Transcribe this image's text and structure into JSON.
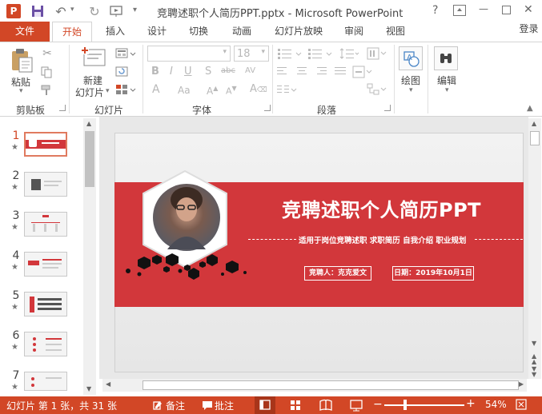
{
  "window": {
    "title": "竞聘述职个人简历PPT.pptx - Microsoft PowerPoint",
    "help": "?",
    "minimize": "—",
    "close": "✕"
  },
  "tabs": {
    "file": "文件",
    "home": "开始",
    "insert": "插入",
    "design": "设计",
    "transitions": "切换",
    "animations": "动画",
    "slideshow": "幻灯片放映",
    "review": "审阅",
    "view": "视图",
    "signin": "登录"
  },
  "ribbon": {
    "clipboard": {
      "paste": "粘贴",
      "label": "剪贴板"
    },
    "slides": {
      "new_slide_line1": "新建",
      "new_slide_line2": "幻灯片",
      "label": "幻灯片"
    },
    "font": {
      "font_name": "",
      "font_size": "18",
      "label": "字体"
    },
    "paragraph": {
      "label": "段落"
    },
    "drawing": {
      "label": "绘图"
    },
    "editing": {
      "label": "编辑"
    }
  },
  "thumbnails": [
    {
      "num": "1",
      "star": "★",
      "selected": true
    },
    {
      "num": "2",
      "star": "★",
      "selected": false
    },
    {
      "num": "3",
      "star": "★",
      "selected": false
    },
    {
      "num": "4",
      "star": "★",
      "selected": false
    },
    {
      "num": "5",
      "star": "★",
      "selected": false
    },
    {
      "num": "6",
      "star": "★",
      "selected": false
    },
    {
      "num": "7",
      "star": "★",
      "selected": false
    }
  ],
  "slide": {
    "title": "竞聘述职个人简历PPT",
    "subtitle": "适用于岗位竞聘述职 求职简历 自我介绍 职业规划",
    "presenter": "竞聘人：克克爱文",
    "date": "日期：2019年10月1日"
  },
  "status": {
    "slide_info": "幻灯片 第 1 张，共 31 张",
    "notes": "备注",
    "comments": "批注",
    "zoom": "54%"
  },
  "colors": {
    "accent": "#d24726",
    "banner": "#d2373b",
    "status": "#d24726"
  }
}
